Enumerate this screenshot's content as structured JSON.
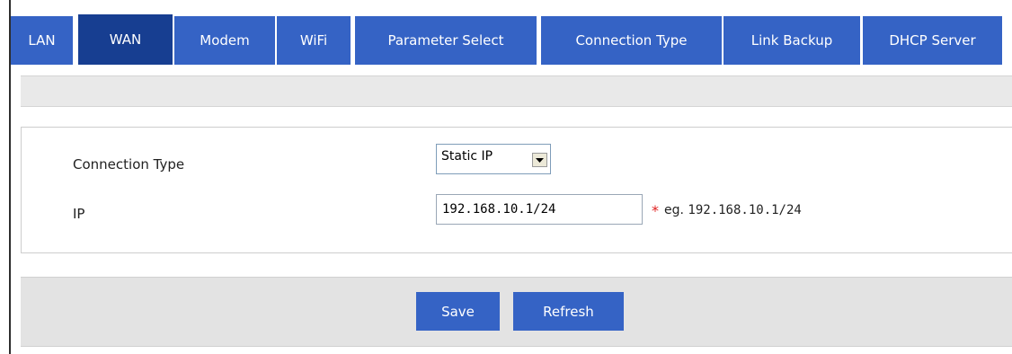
{
  "tabs": [
    {
      "label": "LAN",
      "active": false
    },
    {
      "label": "WAN",
      "active": true
    },
    {
      "label": "Modem",
      "active": false
    },
    {
      "label": "WiFi",
      "active": false
    },
    {
      "label": "Parameter Select",
      "active": false
    },
    {
      "label": "Connection Type",
      "active": false
    },
    {
      "label": "Link Backup",
      "active": false
    },
    {
      "label": "DHCP Server",
      "active": false
    }
  ],
  "form": {
    "connection_type": {
      "label": "Connection Type",
      "selected": "Static IP"
    },
    "ip": {
      "label": "IP",
      "value": "192.168.10.1/24",
      "required_mark": "*",
      "hint_prefix": "eg.",
      "hint_example": "192.168.10.1/24"
    }
  },
  "buttons": {
    "save": "Save",
    "refresh": "Refresh"
  },
  "colors": {
    "tab": "#3563c5",
    "tab_active": "#173e91",
    "required": "#e02020"
  },
  "icons": {
    "dropdown": "triangle-down"
  }
}
